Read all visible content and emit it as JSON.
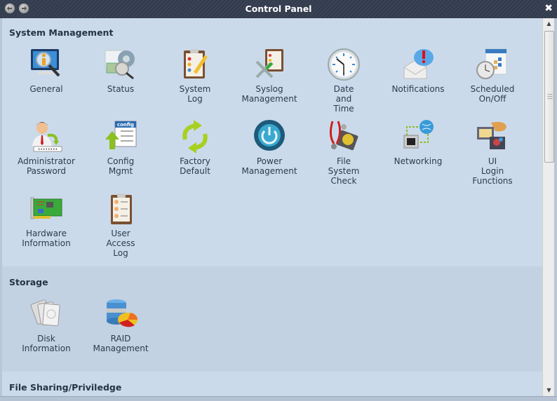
{
  "window": {
    "title": "Control Panel",
    "back_icon": "back-arrow-icon",
    "forward_icon": "forward-arrow-icon",
    "close_icon": "close-x-icon",
    "close_glyph": "✖"
  },
  "sections": {
    "system": {
      "title": "System Management",
      "items": [
        {
          "label": "General",
          "icon": "monitor-info-icon"
        },
        {
          "label": "Status",
          "icon": "status-gear-icon"
        },
        {
          "label": "System\nLog",
          "icon": "clipboard-pencil-icon"
        },
        {
          "label": "Syslog\nManagement",
          "icon": "tools-clipboard-icon"
        },
        {
          "label": "Date\nand\nTime",
          "icon": "clock-icon"
        },
        {
          "label": "Notifications",
          "icon": "envelope-alert-icon"
        },
        {
          "label": "Scheduled\nOn/Off",
          "icon": "calendar-clock-icon"
        },
        {
          "label": "Administrator\nPassword",
          "icon": "admin-password-icon"
        },
        {
          "label": "Config\nMgmt",
          "icon": "config-upload-icon"
        },
        {
          "label": "Factory\nDefault",
          "icon": "refresh-arrows-icon"
        },
        {
          "label": "Power\nManagement",
          "icon": "power-icon"
        },
        {
          "label": "File\nSystem\nCheck",
          "icon": "stethoscope-disk-icon"
        },
        {
          "label": "Networking",
          "icon": "network-globe-icon"
        },
        {
          "label": "UI\nLogin\nFunctions",
          "icon": "ui-login-icon"
        },
        {
          "label": "Hardware\nInformation",
          "icon": "circuit-board-icon"
        },
        {
          "label": "User\nAccess\nLog",
          "icon": "user-clipboard-icon"
        }
      ]
    },
    "storage": {
      "title": "Storage",
      "items": [
        {
          "label": "Disk\nInformation",
          "icon": "hard-disks-icon"
        },
        {
          "label": "RAID\nManagement",
          "icon": "database-chart-icon"
        }
      ]
    },
    "file_sharing": {
      "title": "File Sharing/Priviledge"
    }
  },
  "scrollbar": {
    "up_glyph": "▲",
    "down_glyph": "▼"
  }
}
